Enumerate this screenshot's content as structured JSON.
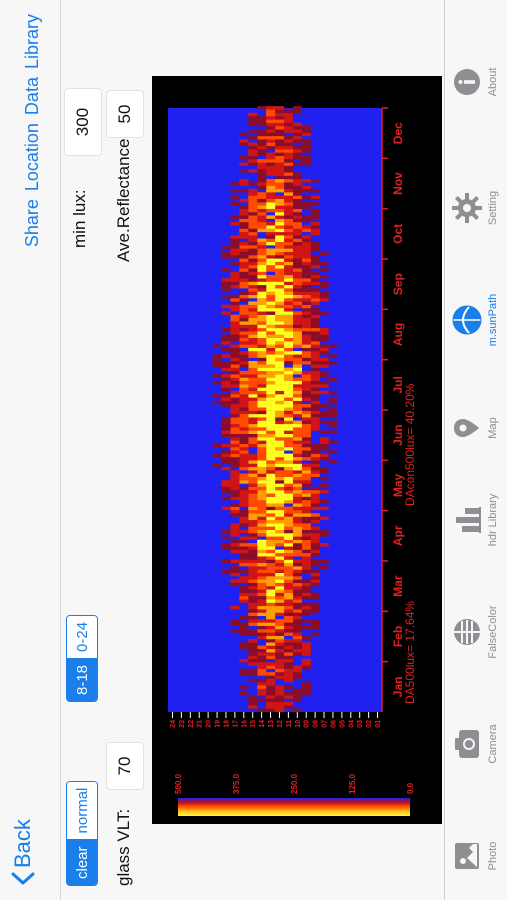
{
  "nav": {
    "back_label": "Back",
    "actions": [
      "Share",
      "Location",
      "Data",
      "Library"
    ]
  },
  "controls": {
    "sky_options": [
      "clear",
      "normal"
    ],
    "sky_selected": "clear",
    "hour_options": [
      "8-18",
      "0-24"
    ],
    "hour_selected": "8-18",
    "glass_vlt_label": "glass VLT:",
    "glass_vlt_value": "70",
    "min_lux_label": "min lux:",
    "min_lux_value": "300",
    "reflectance_label": "Ave.Reflectance:",
    "reflectance_value": "50"
  },
  "chart_data": {
    "type": "heatmap",
    "x_categories": [
      "Jan",
      "Feb",
      "Mar",
      "Apr",
      "May",
      "Jun",
      "Jul",
      "Aug",
      "Sep",
      "Oct",
      "Nov",
      "Dec"
    ],
    "y_ticks": [
      "01",
      "02",
      "03",
      "04",
      "05",
      "06",
      "07",
      "08",
      "09",
      "10",
      "11",
      "12",
      "13",
      "14",
      "15",
      "16",
      "17",
      "18",
      "19",
      "20",
      "21",
      "22",
      "23",
      "24"
    ],
    "colorbar_ticks": [
      "0.0",
      "125.0",
      "250.0",
      "375.0",
      "500.0"
    ],
    "colorbar_range": [
      0,
      500
    ],
    "annotations": [
      "DA500lux= 17.64%",
      "DAcon500lux= 40.20%"
    ],
    "colors": {
      "background": "#000000",
      "plot": "#2020f0",
      "label": "#e02020",
      "high": "#ffff20",
      "mid": "#ff6600",
      "low": "#c01010"
    }
  },
  "tabs": [
    {
      "label": "Photo",
      "icon": "photo-icon"
    },
    {
      "label": "Camera",
      "icon": "camera-icon"
    },
    {
      "label": "FalseColor",
      "icon": "falsecolor-icon"
    },
    {
      "label": "hdr Library",
      "icon": "library-icon"
    },
    {
      "label": "Map",
      "icon": "map-pin-icon"
    },
    {
      "label": "m.sunPath",
      "icon": "sunpath-icon",
      "active": true
    },
    {
      "label": "Setting",
      "icon": "gear-icon"
    },
    {
      "label": "About",
      "icon": "info-icon"
    }
  ],
  "accent_color": "#1a7fe8"
}
